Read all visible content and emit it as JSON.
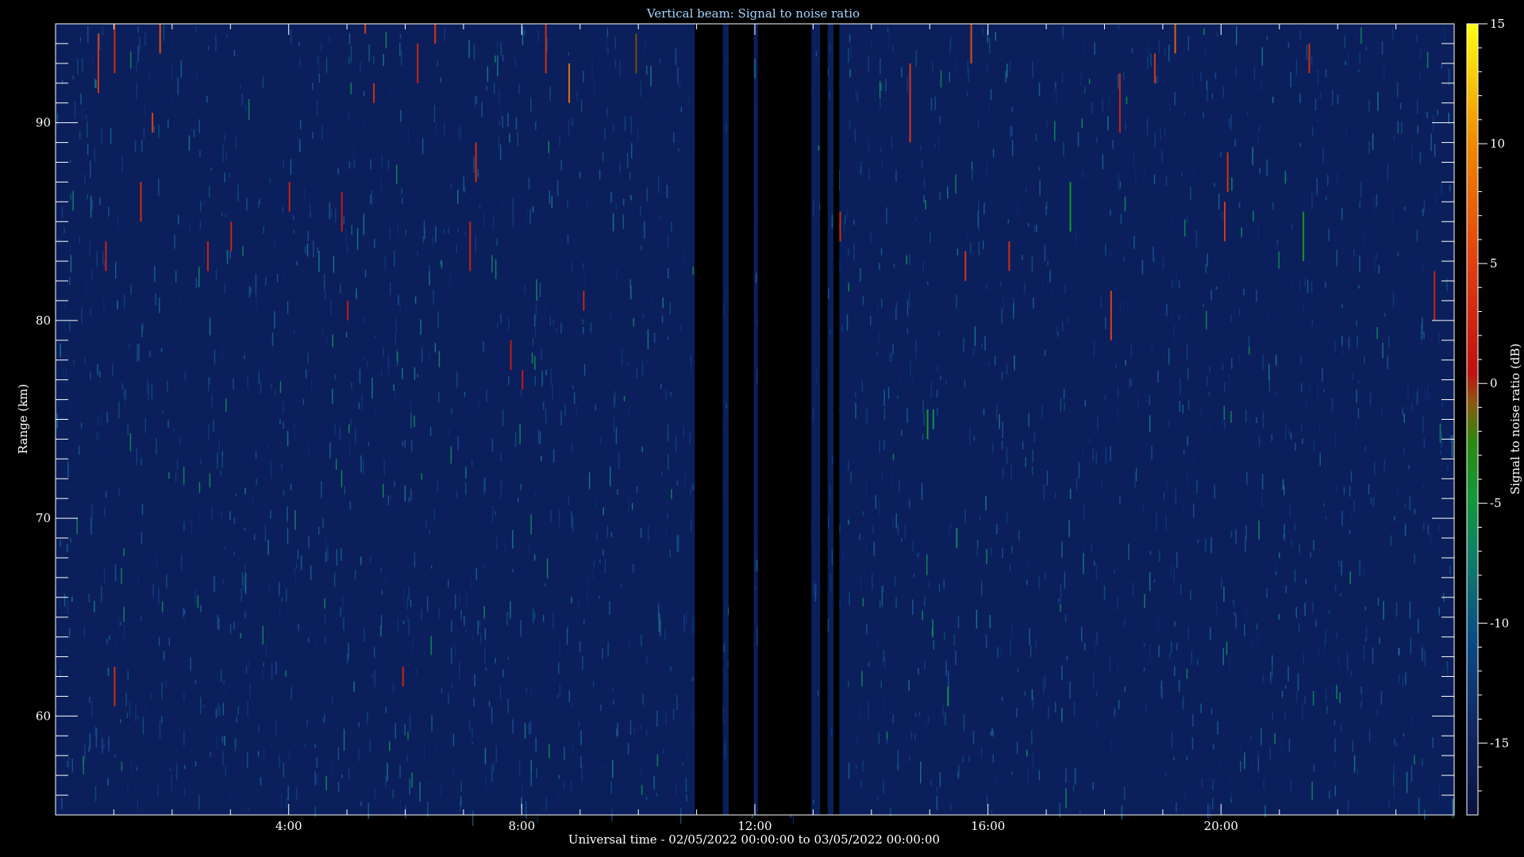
{
  "chart_data": {
    "type": "heatmap",
    "title": "Vertical beam: Signal to noise ratio",
    "xlabel": "Universal time - 02/05/2022 00:00:00 to 03/05/2022 00:00:00",
    "ylabel": "Range (km)",
    "colorbar_label": "Signal to noise ratio (dB)",
    "x_unit": "hours UT",
    "xlim": [
      0,
      24
    ],
    "ylim": [
      55,
      95
    ],
    "clim": [
      -18,
      15
    ],
    "x_major_ticks": [
      4,
      8,
      12,
      16,
      20
    ],
    "x_tick_labels": [
      "4:00",
      "8:00",
      "12:00",
      "16:00",
      "20:00"
    ],
    "y_major_ticks": [
      60,
      70,
      80,
      90
    ],
    "y_tick_labels": [
      "60",
      "70",
      "80",
      "90"
    ],
    "colorbar_ticks": [
      15,
      10,
      5,
      0,
      -5,
      -10,
      -15
    ],
    "colorbar_tick_labels": [
      "15",
      "10",
      "5",
      "0",
      "-5",
      "-10",
      "-15"
    ],
    "background_snr_db": -15,
    "data_gaps": [
      [
        10.97,
        11.45
      ],
      [
        11.55,
        11.98
      ],
      [
        12.05,
        12.97
      ],
      [
        13.12,
        13.25
      ],
      [
        13.35,
        13.45
      ]
    ],
    "echoes": [
      {
        "t": 0.72,
        "r0": 91.5,
        "r1": 94.5,
        "snr": 4
      },
      {
        "t": 1.0,
        "r0": 92.5,
        "r1": 95.0,
        "snr": 3
      },
      {
        "t": 1.65,
        "r0": 89.5,
        "r1": 90.5,
        "snr": 5
      },
      {
        "t": 1.45,
        "r0": 85.0,
        "r1": 87.0,
        "snr": 3
      },
      {
        "t": 0.85,
        "r0": 82.5,
        "r1": 84.0,
        "snr": 2
      },
      {
        "t": 1.78,
        "r0": 93.5,
        "r1": 95.0,
        "snr": 6
      },
      {
        "t": 2.6,
        "r0": 82.5,
        "r1": 84.0,
        "snr": 2
      },
      {
        "t": 3.0,
        "r0": 83.5,
        "r1": 85.0,
        "snr": 2
      },
      {
        "t": 4.0,
        "r0": 85.5,
        "r1": 87.0,
        "snr": 2
      },
      {
        "t": 4.9,
        "r0": 84.5,
        "r1": 86.5,
        "snr": 1
      },
      {
        "t": 5.45,
        "r0": 91.0,
        "r1": 92.0,
        "snr": 3
      },
      {
        "t": 5.3,
        "r0": 94.5,
        "r1": 95.0,
        "snr": 5
      },
      {
        "t": 6.2,
        "r0": 92.0,
        "r1": 94.0,
        "snr": 2
      },
      {
        "t": 6.5,
        "r0": 94.0,
        "r1": 95.0,
        "snr": 4
      },
      {
        "t": 7.1,
        "r0": 82.5,
        "r1": 85.0,
        "snr": 2
      },
      {
        "t": 7.2,
        "r0": 87.0,
        "r1": 89.0,
        "snr": 3
      },
      {
        "t": 8.0,
        "r0": 76.5,
        "r1": 77.5,
        "snr": 1
      },
      {
        "t": 8.4,
        "r0": 92.5,
        "r1": 95.0,
        "snr": 3
      },
      {
        "t": 8.8,
        "r0": 91.0,
        "r1": 93.0,
        "snr": 8
      },
      {
        "t": 9.05,
        "r0": 80.5,
        "r1": 81.5,
        "snr": 2
      },
      {
        "t": 9.95,
        "r0": 92.5,
        "r1": 94.5,
        "snr": -1
      },
      {
        "t": 5.0,
        "r0": 80.0,
        "r1": 81.0,
        "snr": 1
      },
      {
        "t": 7.8,
        "r0": 77.5,
        "r1": 79.0,
        "snr": 1
      },
      {
        "t": 13.45,
        "r0": 84.0,
        "r1": 85.5,
        "snr": 3
      },
      {
        "t": 14.65,
        "r0": 89.0,
        "r1": 93.0,
        "snr": 4
      },
      {
        "t": 15.7,
        "r0": 93.0,
        "r1": 95.0,
        "snr": 6
      },
      {
        "t": 15.6,
        "r0": 82.0,
        "r1": 83.5,
        "snr": 4
      },
      {
        "t": 14.95,
        "r0": 74.0,
        "r1": 75.5,
        "snr": -4
      },
      {
        "t": 15.05,
        "r0": 74.5,
        "r1": 75.5,
        "snr": -6
      },
      {
        "t": 15.45,
        "r0": 68.5,
        "r1": 69.5,
        "snr": -7
      },
      {
        "t": 15.3,
        "r0": 60.5,
        "r1": 61.5,
        "snr": -6
      },
      {
        "t": 16.35,
        "r0": 82.5,
        "r1": 84.0,
        "snr": 3
      },
      {
        "t": 18.1,
        "r0": 79.0,
        "r1": 81.5,
        "snr": 5
      },
      {
        "t": 18.25,
        "r0": 89.5,
        "r1": 92.5,
        "snr": 2
      },
      {
        "t": 18.85,
        "r0": 92.0,
        "r1": 93.5,
        "snr": 4
      },
      {
        "t": 19.2,
        "r0": 93.5,
        "r1": 95.0,
        "snr": 7
      },
      {
        "t": 20.05,
        "r0": 84.0,
        "r1": 86.0,
        "snr": 4
      },
      {
        "t": 20.1,
        "r0": 86.5,
        "r1": 88.5,
        "snr": 3
      },
      {
        "t": 21.5,
        "r0": 92.5,
        "r1": 94.0,
        "snr": 3
      },
      {
        "t": 23.65,
        "r0": 80.0,
        "r1": 82.5,
        "snr": 2
      },
      {
        "t": 1.0,
        "r0": 60.5,
        "r1": 62.5,
        "snr": 3
      },
      {
        "t": 5.95,
        "r0": 61.5,
        "r1": 62.5,
        "snr": 2
      },
      {
        "t": 17.4,
        "r0": 84.5,
        "r1": 87.0,
        "snr": -4
      },
      {
        "t": 21.4,
        "r0": 83.0,
        "r1": 85.5,
        "snr": -3
      }
    ]
  },
  "colors": {
    "background": "#000000",
    "axis": "#ffffff",
    "title": "#a6d6ff",
    "noise_base": "#0a1f5c"
  }
}
